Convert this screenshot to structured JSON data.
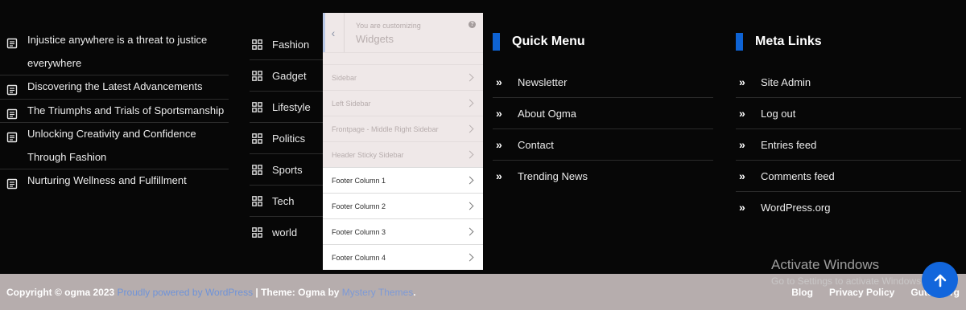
{
  "recent_posts": [
    "Injustice anywhere is a threat to justice everywhere",
    "Discovering the Latest Advancements",
    "The Triumphs and Trials of Sportsmanship",
    "Unlocking Creativity and Confidence Through Fashion",
    "Nurturing Wellness and Fulfillment"
  ],
  "categories": [
    "Fashion",
    "Gadget",
    "Lifestyle",
    "Politics",
    "Sports",
    "Tech",
    "world"
  ],
  "customizer": {
    "subtitle": "You are customizing",
    "title": "Widgets",
    "help_icon": "?",
    "inactive_areas": [
      "Sidebar",
      "Left Sidebar",
      "Frontpage - Middle Right Sidebar",
      "Header Sticky Sidebar"
    ],
    "footer_areas": [
      "Footer Column 1",
      "Footer Column 2",
      "Footer Column 3",
      "Footer Column 4"
    ]
  },
  "quick_menu": {
    "title": "Quick Menu",
    "links": [
      "Newsletter",
      "About Ogma",
      "Contact",
      "Trending News"
    ]
  },
  "meta_links": {
    "title": "Meta Links",
    "links": [
      "Site Admin",
      "Log out",
      "Entries feed",
      "Comments feed",
      "WordPress.org"
    ]
  },
  "footer": {
    "copyright": "Copyright © ogma 2023 ",
    "powered": "Proudly powered by WordPress",
    "theme_label": " | Theme: Ogma by ",
    "theme_author": "Mystery Themes",
    "period": ".",
    "links": [
      "Blog",
      "Privacy Policy",
      "Gutenberg"
    ]
  },
  "activate_windows": {
    "title": "Activate Windows",
    "subtitle": "Go to Settings to activate Windows."
  },
  "colors": {
    "accent": "#0e63d4",
    "background": "#070707",
    "bottom_bar": "#b6adad"
  }
}
